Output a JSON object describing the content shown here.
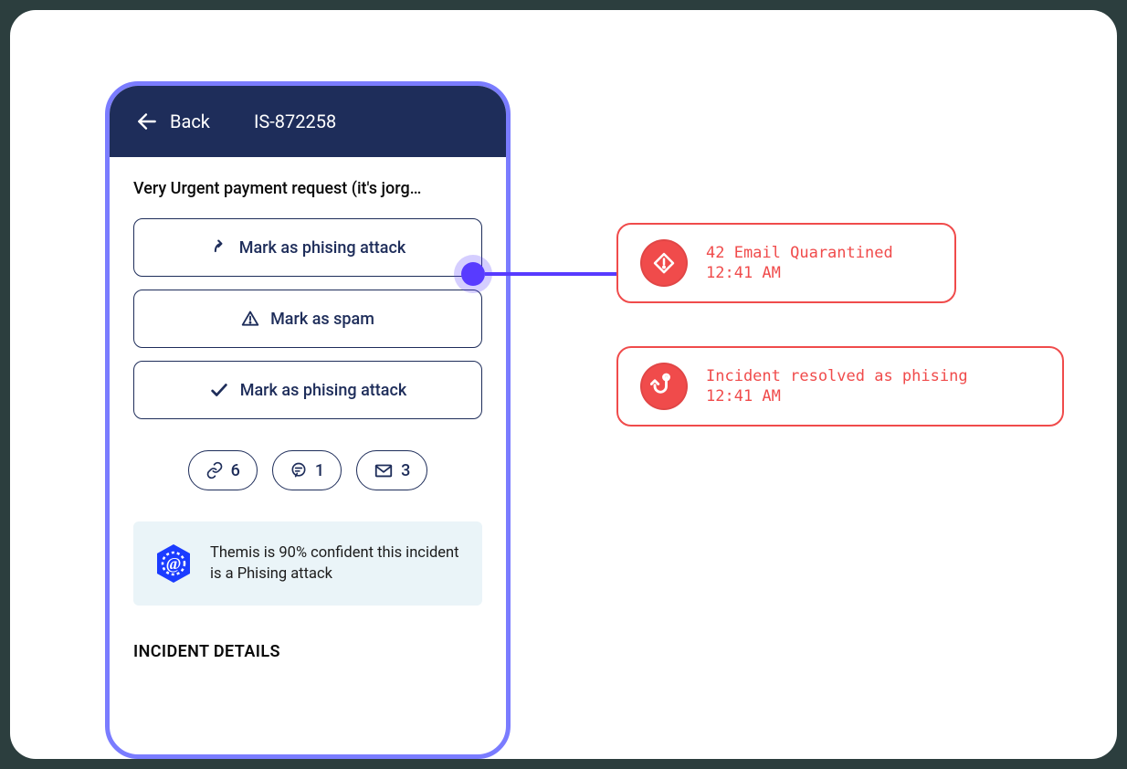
{
  "header": {
    "back_label": "Back",
    "incident_id": "IS-872258"
  },
  "incident": {
    "title": "Very Urgent payment request (it's jorg…"
  },
  "actions": [
    {
      "id": "mark-phishing-1",
      "label": "Mark as phising attack",
      "icon": "arrow-up-curve"
    },
    {
      "id": "mark-spam",
      "label": "Mark as spam",
      "icon": "warning-triangle"
    },
    {
      "id": "mark-phishing-2",
      "label": "Mark as phising attack",
      "icon": "check"
    }
  ],
  "counts": {
    "links": "6",
    "comments": "1",
    "emails": "3"
  },
  "confidence": {
    "text": "Themis is 90% confident this incident is a Phising attack"
  },
  "section_heading": "INCIDENT DETAILS",
  "alerts": [
    {
      "title": "42 Email Quarantined",
      "time": "12:41 AM",
      "icon": "diamond-alert"
    },
    {
      "title": "Incident resolved as phising",
      "time": "12:41 AM",
      "icon": "hook"
    }
  ]
}
